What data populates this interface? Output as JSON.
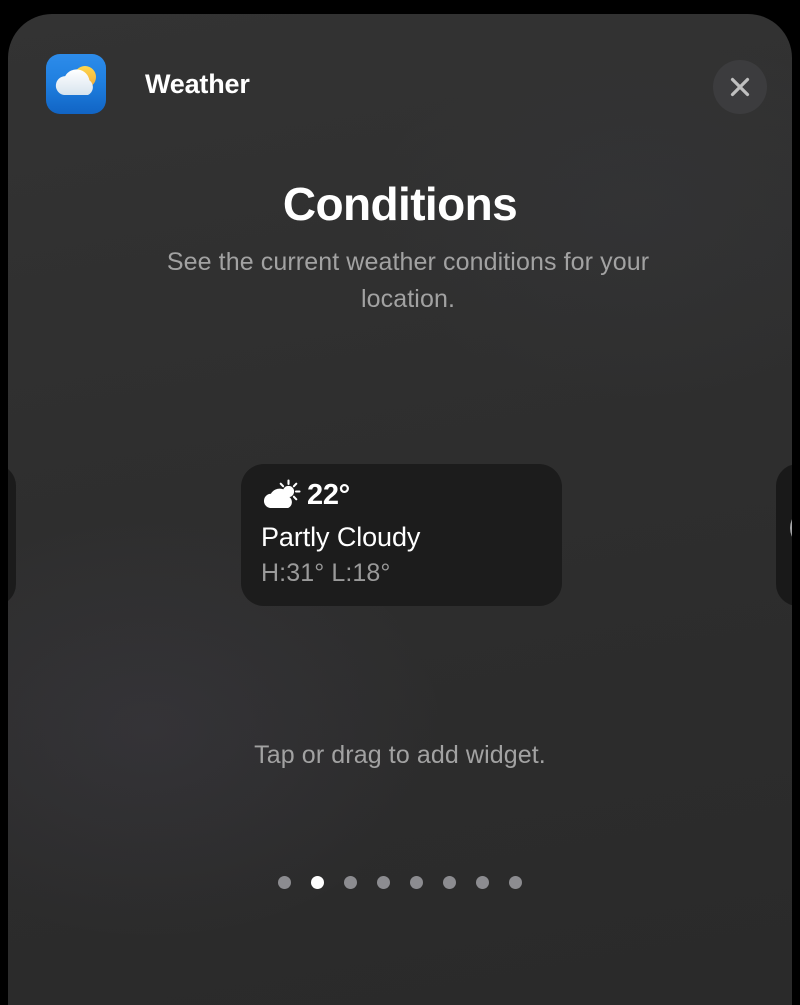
{
  "header": {
    "app_name": "Weather",
    "app_icon": "weather-app-icon",
    "close_label": "Close",
    "close_icon": "close-icon"
  },
  "detail": {
    "title": "Conditions",
    "subtitle": "See the current weather conditions for your location."
  },
  "widget": {
    "weather_icon": "partly-cloudy-icon",
    "temperature": "22°",
    "condition": "Partly Cloudy",
    "high_low": "H:31° L:18°"
  },
  "carousel": {
    "peek_left_icon": "moon-icon",
    "peek_right_icon": "moon-icon",
    "hint": "Tap or drag to add widget.",
    "page_count": 8,
    "active_page": 2,
    "dots": [
      {
        "active": false
      },
      {
        "active": true
      },
      {
        "active": false
      },
      {
        "active": false
      },
      {
        "active": false
      },
      {
        "active": false
      },
      {
        "active": false
      },
      {
        "active": false
      }
    ]
  },
  "colors": {
    "sheet_background": "#2e2e2e",
    "card_background": "#1c1c1c",
    "page_background": "#000000",
    "accent_icon_blue": "#1f7fe0",
    "accent_sun_yellow": "#f7c948",
    "text_primary": "#ffffff",
    "text_secondary": "#a2a2a2",
    "dot_active": "#ffffff",
    "dot_inactive": "#8c8c90"
  }
}
